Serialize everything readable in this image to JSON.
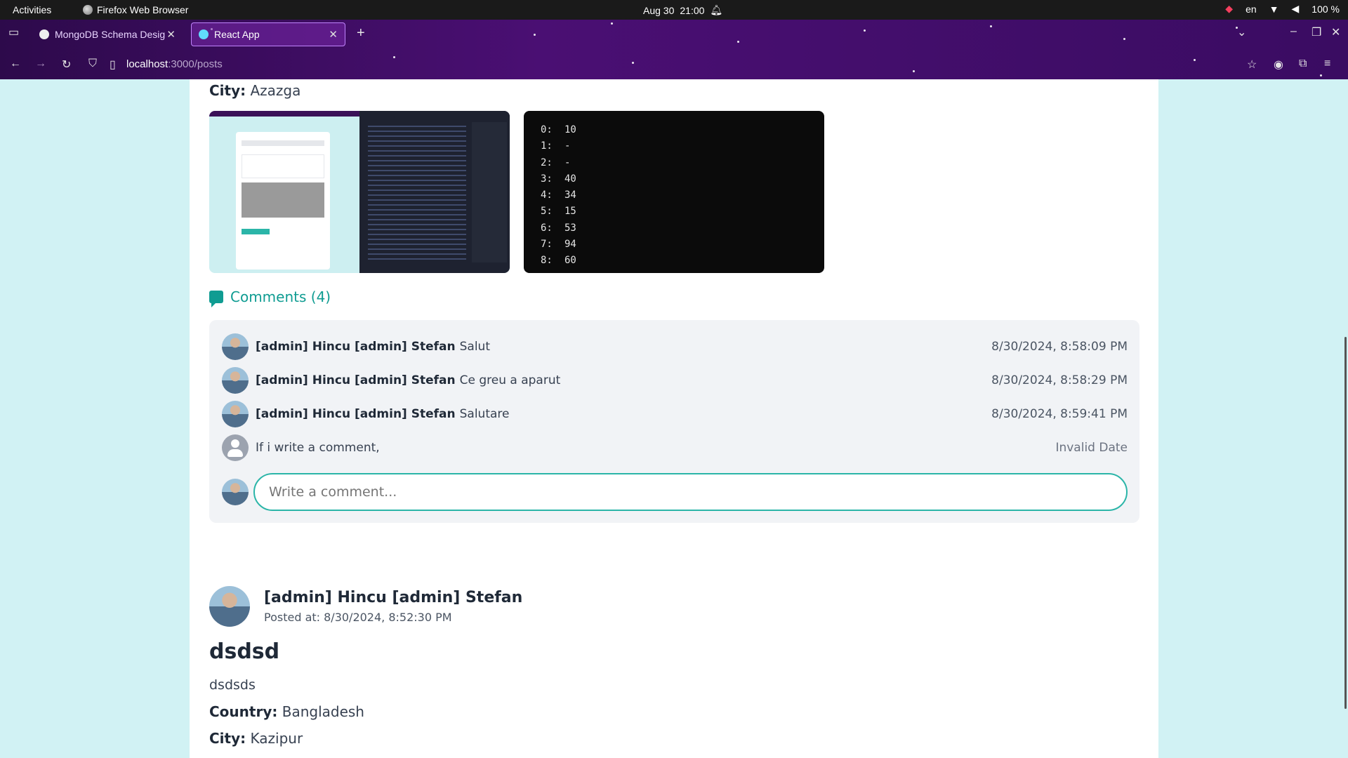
{
  "system": {
    "activities": "Activities",
    "app_name": "Firefox Web Browser",
    "date": "Aug 30",
    "time": "21:00",
    "lang": "en",
    "battery": "100 %"
  },
  "browser": {
    "tabs": [
      {
        "label": "MongoDB Schema Desig"
      },
      {
        "label": "React App"
      }
    ],
    "url_host": "localhost",
    "url_path": ":3000/posts"
  },
  "post1": {
    "city_label": "City:",
    "city": "Azazga",
    "terminal_lines": [
      {
        "idx": "0:",
        "val": "10"
      },
      {
        "idx": "1:",
        "val": "-"
      },
      {
        "idx": "2:",
        "val": "-"
      },
      {
        "idx": "3:",
        "val": "40"
      },
      {
        "idx": "4:",
        "val": "34"
      },
      {
        "idx": "5:",
        "val": "15"
      },
      {
        "idx": "6:",
        "val": "53"
      },
      {
        "idx": "7:",
        "val": "94"
      },
      {
        "idx": "8:",
        "val": "60"
      }
    ],
    "comments_link": "Comments (4)",
    "comments": [
      {
        "author": "[admin] Hincu [admin] Stefan",
        "text": "Salut",
        "date": "8/30/2024, 8:58:09 PM"
      },
      {
        "author": "[admin] Hincu [admin] Stefan",
        "text": "Ce greu a aparut",
        "date": "8/30/2024, 8:58:29 PM"
      },
      {
        "author": "[admin] Hincu [admin] Stefan",
        "text": "Salutare",
        "date": "8/30/2024, 8:59:41 PM"
      },
      {
        "author": "",
        "text": "If i write a comment,",
        "date": "Invalid Date"
      }
    ],
    "comment_placeholder": "Write a comment..."
  },
  "post2": {
    "author": "[admin] Hincu [admin] Stefan",
    "posted_at": "Posted at: 8/30/2024, 8:52:30 PM",
    "title": "dsdsd",
    "body": "dsdsds",
    "country_label": "Country:",
    "country": "Bangladesh",
    "city_label": "City:",
    "city": "Kazipur"
  },
  "colors": {
    "accent": "#0f9c92",
    "page_bg": "#d1f2f4",
    "browser_theme": "#4a0f73"
  }
}
